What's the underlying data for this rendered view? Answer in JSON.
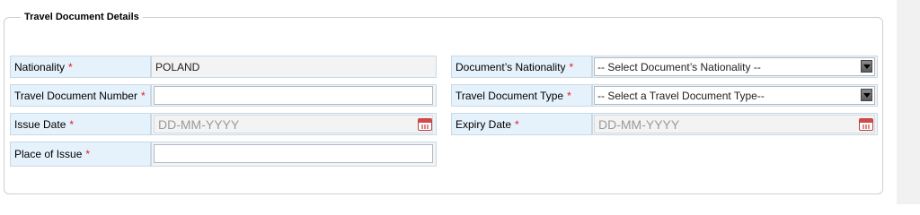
{
  "section": {
    "title": "Travel Document Details",
    "required_marker": "*"
  },
  "left": {
    "nationality": {
      "label": "Nationality",
      "value": "POLAND"
    },
    "travel_document_number": {
      "label": "Travel Document Number",
      "value": ""
    },
    "issue_date": {
      "label": "Issue Date",
      "placeholder": "DD-MM-YYYY"
    },
    "place_of_issue": {
      "label": "Place of Issue",
      "value": ""
    }
  },
  "right": {
    "documents_nationality": {
      "label": "Document’s Nationality",
      "selected": "-- Select Document’s Nationality --"
    },
    "travel_document_type": {
      "label": "Travel Document Type",
      "selected": "-- Select a Travel Document Type--"
    },
    "expiry_date": {
      "label": "Expiry Date",
      "placeholder": "DD-MM-YYYY"
    }
  },
  "icons": {
    "calendar": "calendar-icon",
    "dropdown": "chevron-down-icon"
  },
  "colors": {
    "label_bg": "#e5f1fb",
    "required": "#e02020"
  }
}
